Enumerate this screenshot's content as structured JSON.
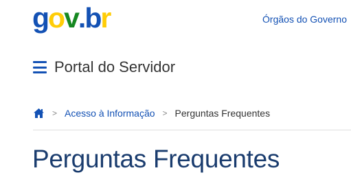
{
  "header": {
    "logo": {
      "g": "g",
      "o": "o",
      "v": "v",
      "dot": ".",
      "b": "b",
      "r": "r"
    },
    "orgs_link": "Órgãos do Governo"
  },
  "portal": {
    "menu_icon": "hamburger-menu-icon",
    "title": "Portal do Servidor"
  },
  "breadcrumb": {
    "home_icon": "home-icon",
    "separator": ">",
    "items": [
      {
        "label": "Acesso à Informação"
      },
      {
        "label": "Perguntas Frequentes"
      }
    ]
  },
  "main": {
    "title": "Perguntas Frequentes"
  },
  "colors": {
    "brand_blue": "#1351b4",
    "brand_yellow": "#ffcd07",
    "brand_green": "#168821",
    "title_blue": "#1a3c6e"
  }
}
